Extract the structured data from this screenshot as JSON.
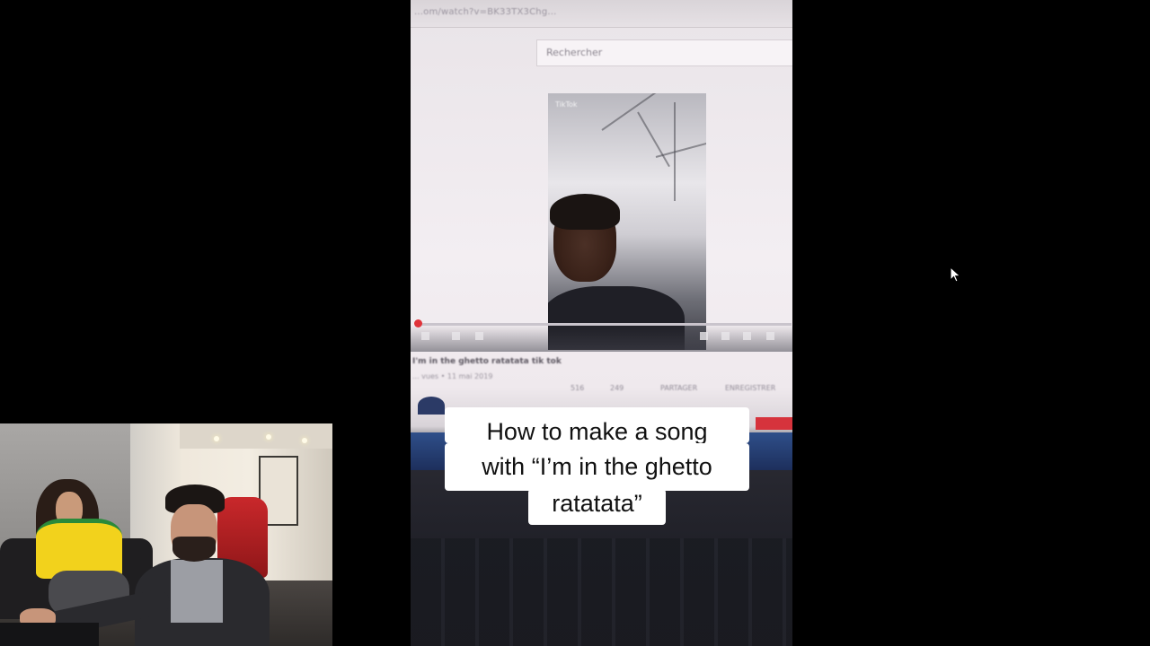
{
  "video": {
    "caption_lines": [
      "How to make a song",
      "with “I’m in the ghetto",
      "ratatata”"
    ]
  },
  "filmed_screen": {
    "url_text": "...om/watch?v=BK33TX3Chg...",
    "search_placeholder": "Rechercher",
    "inner_video_tag": "TikTok",
    "video_title": "I'm in the ghetto ratatata tik tok",
    "video_meta": "... vues • 11 mai 2019",
    "actions": [
      "516",
      "249",
      "PARTAGER",
      "ENREGISTRER"
    ]
  },
  "cursor": {
    "icon": "mouse-pointer-icon"
  }
}
